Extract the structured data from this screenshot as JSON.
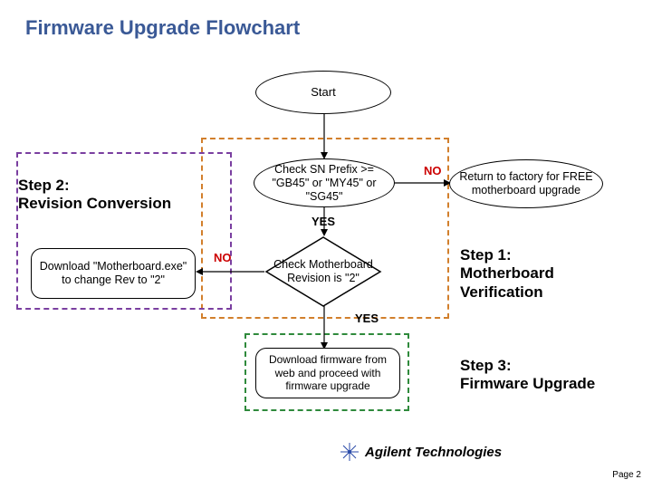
{
  "title": "Firmware Upgrade Flowchart",
  "start": "Start",
  "check_sn": "Check SN Prefix >= \"GB45\" or \"MY45\" or \"SG45\"",
  "step2_label": "Step 2:\nRevision Conversion",
  "no1": "NO",
  "factory": "Return to factory for FREE motherboard upgrade",
  "yes1": "YES",
  "download_mb": "Download \"Motherboard.exe\" to change Rev to \"2\"",
  "no2": "NO",
  "check_rev": "Check Motherboard Revision is \"2\"",
  "yes2": "YES",
  "step1_label": "Step 1:\nMotherboard\nVerification",
  "dl_fw": "Download firmware from web and proceed with firmware upgrade",
  "step3_label": "Step 3:\nFirmware Upgrade",
  "logo": "Agilent Technologies",
  "page": "Page 2",
  "chart_data": {
    "type": "flowchart",
    "nodes": [
      {
        "id": "start",
        "kind": "terminator",
        "label": "Start"
      },
      {
        "id": "check_sn",
        "kind": "process",
        "label": "Check SN Prefix >= \"GB45\" or \"MY45\" or \"SG45\""
      },
      {
        "id": "factory",
        "kind": "terminator",
        "label": "Return to factory for FREE motherboard upgrade"
      },
      {
        "id": "check_rev",
        "kind": "decision",
        "label": "Check Motherboard Revision is \"2\""
      },
      {
        "id": "download_mb",
        "kind": "process",
        "label": "Download \"Motherboard.exe\" to change Rev to \"2\""
      },
      {
        "id": "dl_fw",
        "kind": "process",
        "label": "Download firmware from web and proceed with firmware upgrade"
      }
    ],
    "edges": [
      {
        "from": "start",
        "to": "check_sn"
      },
      {
        "from": "check_sn",
        "to": "factory",
        "label": "NO"
      },
      {
        "from": "check_sn",
        "to": "check_rev",
        "label": "YES"
      },
      {
        "from": "check_rev",
        "to": "download_mb",
        "label": "NO"
      },
      {
        "from": "check_rev",
        "to": "dl_fw",
        "label": "YES"
      }
    ],
    "groups": [
      {
        "label": "Step 1: Motherboard Verification",
        "nodes": [
          "check_sn",
          "check_rev"
        ]
      },
      {
        "label": "Step 2: Revision Conversion",
        "nodes": [
          "download_mb"
        ]
      },
      {
        "label": "Step 3: Firmware Upgrade",
        "nodes": [
          "dl_fw"
        ]
      }
    ]
  }
}
